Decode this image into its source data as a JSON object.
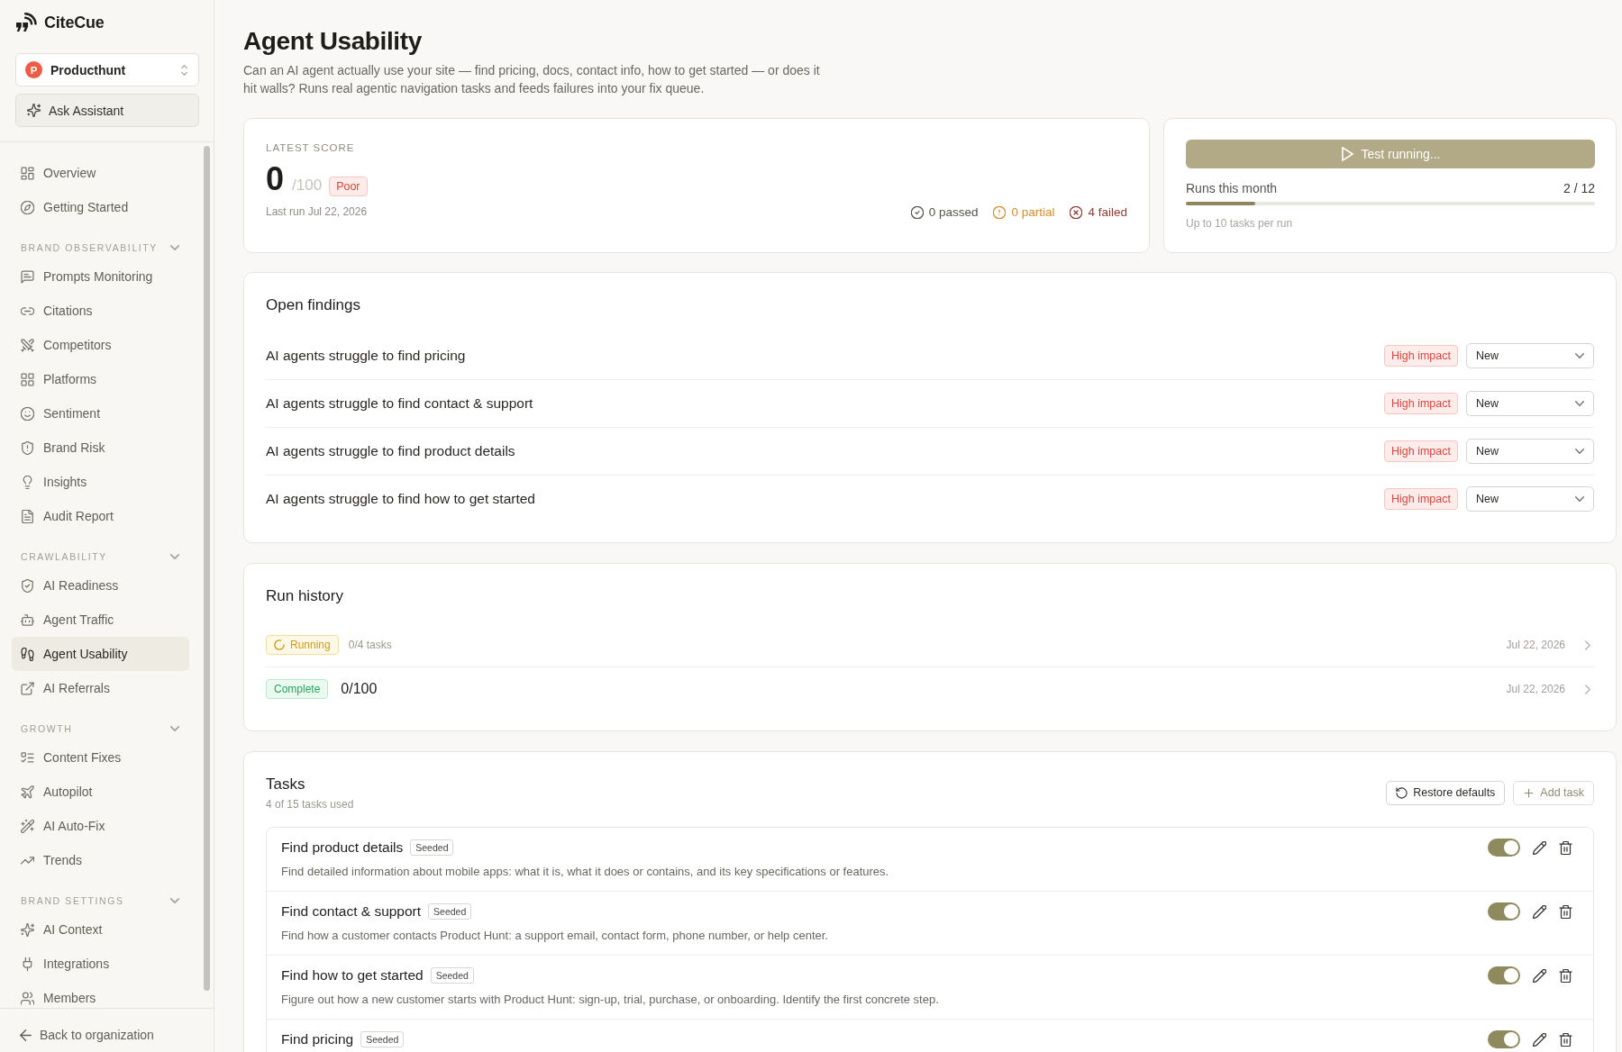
{
  "sidebar": {
    "brand": "CiteCue",
    "workspace": {
      "initial": "P",
      "name": "Producthunt"
    },
    "assistant_button": "Ask Assistant",
    "groups": [
      {
        "items": [
          {
            "label": "Overview",
            "selected": false
          },
          {
            "label": "Getting Started",
            "selected": false
          }
        ]
      },
      {
        "title": "BRAND OBSERVABILITY",
        "expanded": true,
        "items": [
          {
            "label": "Prompts Monitoring",
            "selected": false
          },
          {
            "label": "Citations",
            "selected": false
          },
          {
            "label": "Competitors",
            "selected": false
          },
          {
            "label": "Platforms",
            "selected": false
          },
          {
            "label": "Sentiment",
            "selected": false
          },
          {
            "label": "Brand Risk",
            "selected": false
          },
          {
            "label": "Insights",
            "selected": false
          },
          {
            "label": "Audit Report",
            "selected": false
          }
        ]
      },
      {
        "title": "CRAWLABILITY",
        "expanded": true,
        "items": [
          {
            "label": "AI Readiness",
            "selected": false
          },
          {
            "label": "Agent Traffic",
            "selected": false
          },
          {
            "label": "Agent Usability",
            "selected": true
          },
          {
            "label": "AI Referrals",
            "selected": false
          }
        ]
      },
      {
        "title": "GROWTH",
        "expanded": true,
        "items": [
          {
            "label": "Content Fixes",
            "selected": false
          },
          {
            "label": "Autopilot",
            "selected": false
          },
          {
            "label": "AI Auto-Fix",
            "selected": false
          },
          {
            "label": "Trends",
            "selected": false
          }
        ]
      },
      {
        "title": "BRAND SETTINGS",
        "expanded": true,
        "items": [
          {
            "label": "AI Context",
            "selected": false
          },
          {
            "label": "Integrations",
            "selected": false
          },
          {
            "label": "Members",
            "selected": false
          }
        ]
      }
    ],
    "back_link": "Back to organization"
  },
  "header": {
    "title": "Agent Usability",
    "description": "Can an AI agent actually use your site — find pricing, docs, contact info, how to get started — or does it hit walls? Runs real agentic navigation tasks and feeds failures into your fix queue."
  },
  "score_card": {
    "label": "LATEST SCORE",
    "score": "0",
    "max": "/100",
    "rating": "Poor",
    "last_run": "Last run Jul 22, 2026",
    "stats": [
      {
        "kind": "passed",
        "label": "0 passed"
      },
      {
        "kind": "partial",
        "label": "0 partial"
      },
      {
        "kind": "failed",
        "label": "4 failed"
      }
    ]
  },
  "usage_card": {
    "button": {
      "label": "Test running...",
      "disabled": true
    },
    "label": "Runs this month",
    "value": "2 / 12",
    "level": 0.17,
    "note": "Up to 10 tasks per run"
  },
  "findings": {
    "title": "Open findings",
    "items": [
      {
        "title": "AI agents struggle to find pricing",
        "impact": "High impact",
        "status": "New"
      },
      {
        "title": "AI agents struggle to find contact & support",
        "impact": "High impact",
        "status": "New"
      },
      {
        "title": "AI agents struggle to find product details",
        "impact": "High impact",
        "status": "New"
      },
      {
        "title": "AI agents struggle to find how to get started",
        "impact": "High impact",
        "status": "New"
      }
    ]
  },
  "run_history": {
    "title": "Run history",
    "runs": [
      {
        "kind": "running",
        "status": "Running",
        "detail": "0/4 tasks",
        "date": "Jul 22, 2026"
      },
      {
        "kind": "complete",
        "status": "Complete",
        "detail": "0/100",
        "date": "Jul 22, 2026"
      }
    ]
  },
  "tasks": {
    "title": "Tasks",
    "subtitle": "4 of 15 tasks used",
    "actions": [
      {
        "kind": "restore",
        "label": "Restore defaults",
        "disabled": false
      },
      {
        "kind": "add",
        "label": "Add task",
        "disabled": true
      }
    ],
    "items": [
      {
        "title": "Find product details",
        "tag": "Seeded",
        "description": "Find detailed information about mobile apps: what it is, what it does or contains, and its key specifications or features.",
        "on": true
      },
      {
        "title": "Find contact & support",
        "tag": "Seeded",
        "description": "Find how a customer contacts Product Hunt: a support email, contact form, phone number, or help center.",
        "on": true
      },
      {
        "title": "Find how to get started",
        "tag": "Seeded",
        "description": "Figure out how a new customer starts with Product Hunt: sign-up, trial, purchase, or onboarding. Identify the first concrete step.",
        "on": true
      },
      {
        "title": "Find pricing",
        "tag": "Seeded",
        "on": true
      }
    ]
  }
}
